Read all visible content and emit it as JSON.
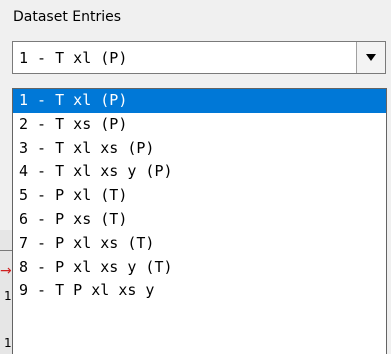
{
  "group_label": "Dataset Entries",
  "combo": {
    "selected": "1 - T xl (P)"
  },
  "list": {
    "items": [
      "1 - T xl (P)",
      "2 - T xs (P)",
      "3 - T xl xs (P)",
      "4 - T xl xs y (P)",
      "5 - P xl (T)",
      "6 - P xs (T)",
      "7 - P xl xs (T)",
      "8 - P xl xs y (T)",
      "9 - T P xl xs y"
    ],
    "selected_index": 0
  },
  "side": {
    "mark1": "1",
    "mark2": "1"
  }
}
